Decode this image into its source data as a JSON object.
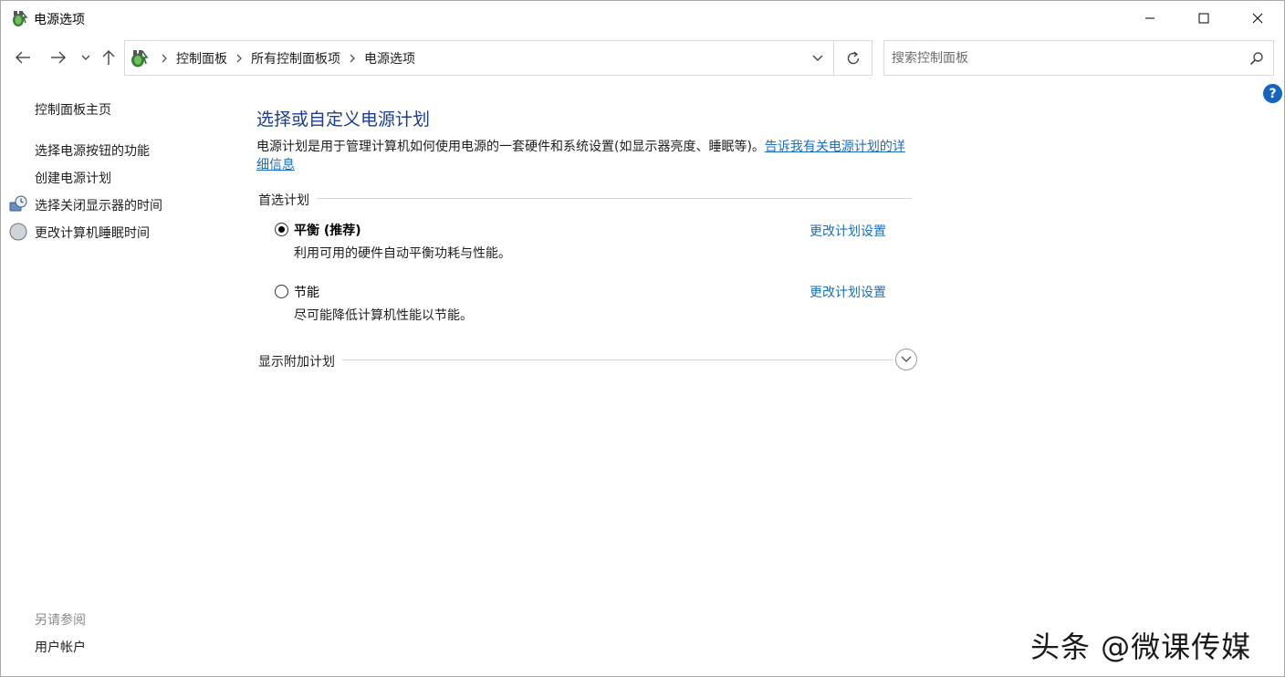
{
  "window": {
    "title": "电源选项",
    "icon": "power-options-icon"
  },
  "nav": {
    "breadcrumbs": [
      "控制面板",
      "所有控制面板项",
      "电源选项"
    ],
    "search_placeholder": "搜索控制面板",
    "help_label": "?"
  },
  "sidebar": {
    "home": "控制面板主页",
    "links": [
      {
        "label": "选择电源按钮的功能",
        "icon": null
      },
      {
        "label": "创建电源计划",
        "icon": null
      },
      {
        "label": "选择关闭显示器的时间",
        "icon": "monitor-clock-icon"
      },
      {
        "label": "更改计算机睡眠时间",
        "icon": "moon-icon"
      }
    ],
    "see_also_title": "另请参阅",
    "see_also_links": [
      "用户帐户"
    ]
  },
  "main": {
    "heading": "选择或自定义电源计划",
    "description": "电源计划是用于管理计算机如何使用电源的一套硬件和系统设置(如显示器亮度、睡眠等)。",
    "description_link": "告诉我有关电源计划的详细信息",
    "preferred_label": "首选计划",
    "plans": [
      {
        "name": "平衡 (推荐)",
        "desc": "利用可用的硬件自动平衡功耗与性能。",
        "selected": true,
        "action": "更改计划设置"
      },
      {
        "name": "节能",
        "desc": "尽可能降低计算机性能以节能。",
        "selected": false,
        "action": "更改计划设置"
      }
    ],
    "additional_label": "显示附加计划"
  },
  "watermark": "头条 @微课传媒",
  "colors": {
    "heading": "#1e3c8c",
    "link": "#1a6fc0",
    "help": "#1565c0"
  }
}
